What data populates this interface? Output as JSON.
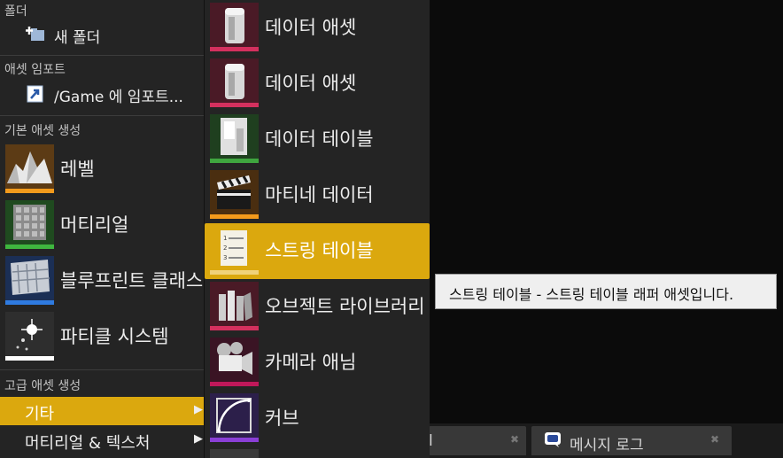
{
  "left_menu": {
    "sections": {
      "folder": "폴더",
      "import": "애셋 임포트",
      "basic": "기본 애셋 생성",
      "advanced": "고급 애셋 생성"
    },
    "new_folder": "새 폴더",
    "import_to": "/Game 에 임포트...",
    "basic_assets": [
      {
        "label": "레벨",
        "icon": "level-icon",
        "color": "#f39a1c"
      },
      {
        "label": "머티리얼",
        "icon": "material-icon",
        "color": "#3fb63f"
      },
      {
        "label": "블루프린트 클래스",
        "icon": "blueprint-icon",
        "color": "#2f7be0"
      },
      {
        "label": "파티클 시스템",
        "icon": "particle-icon",
        "color": "#ffffff"
      }
    ],
    "advanced_items": [
      {
        "label": "기타",
        "selected": true
      },
      {
        "label": "머티리얼 & 텍스처",
        "selected": false
      }
    ]
  },
  "submenu": {
    "items": [
      {
        "label": "데이터 애셋",
        "icon": "data-asset-icon",
        "color": "#d4305e"
      },
      {
        "label": "데이터 애셋",
        "icon": "data-asset-icon",
        "color": "#d4305e"
      },
      {
        "label": "데이터 테이블",
        "icon": "data-table-icon",
        "color": "#3fa53f"
      },
      {
        "label": "마티네 데이터",
        "icon": "matinee-icon",
        "color": "#f39a1c"
      },
      {
        "label": "스트링 테이블",
        "icon": "string-table-icon",
        "color": "#dba80e",
        "selected": true
      },
      {
        "label": "오브젝트 라이브러리",
        "icon": "object-library-icon",
        "color": "#d4305e"
      },
      {
        "label": "카메라 애님",
        "icon": "camera-anim-icon",
        "color": "#c0185a"
      },
      {
        "label": "커브",
        "icon": "curve-icon",
        "color": "#8a3fd6"
      }
    ]
  },
  "tooltip": "스트링 테이블 - 스트링 테이블 래퍼 애셋입니다.",
  "bottom_tabs": {
    "tab1_label": "l",
    "tab2_label": "메시지 로그",
    "close": "✖"
  },
  "arrow": "▶"
}
